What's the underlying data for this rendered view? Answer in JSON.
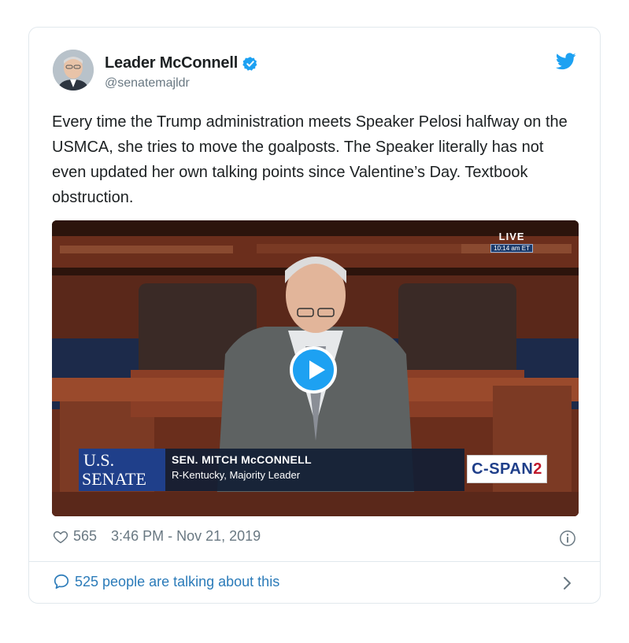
{
  "tweet": {
    "author_name": "Leader McConnell",
    "handle": "@senatemajldr",
    "text": "Every time the Trump administration meets Speaker Pelosi halfway on the USMCA, she tries to move the goalposts. The Speaker literally has not even updated her own talking points since Valentine’s Day. Textbook obstruction.",
    "likes": "565",
    "timestamp": "3:46 PM - Nov 21, 2019",
    "talking": "525 people are talking about this"
  },
  "video": {
    "live_label": "LIVE",
    "live_time": "10:14 am ET",
    "senate_line1": "U.S.",
    "senate_line2": "SENATE",
    "speaker_name": "SEN. MITCH McCONNELL",
    "speaker_title": "R-Kentucky, Majority Leader",
    "network": "C-SPAN",
    "network_number": "2"
  },
  "colors": {
    "brand_blue": "#1da1f2",
    "link_blue": "#2b7bb9",
    "muted_gray": "#697882",
    "border": "#e1e8ed"
  },
  "icons": {
    "verified": "verified-badge-icon",
    "bird": "twitter-bird-icon",
    "heart": "heart-icon",
    "info": "info-icon",
    "bubble": "speech-bubble-icon",
    "chevron": "chevron-right-icon",
    "play": "play-icon"
  }
}
